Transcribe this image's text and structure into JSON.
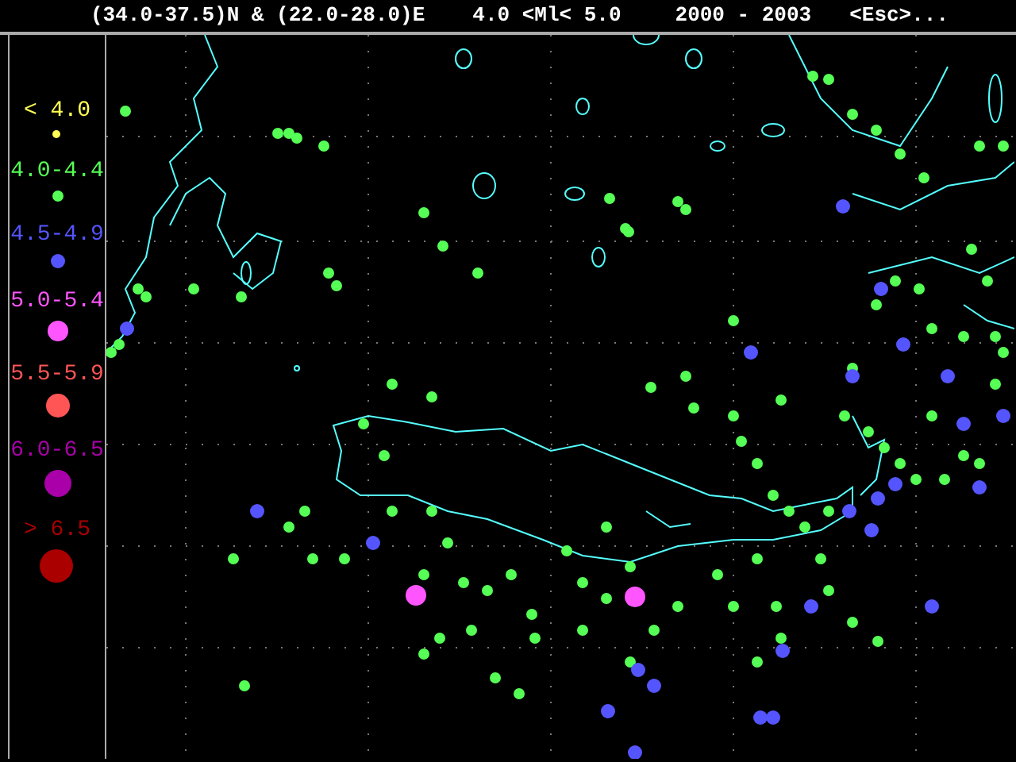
{
  "header": [
    "(34.0-37.5)N & (22.0-28.0)E",
    "4.0 <Ml< 5.0",
    "2000 - 2003",
    "<Esc>..."
  ],
  "legend": [
    {
      "label": "< 4.0",
      "color": "#ffff55"
    },
    {
      "label": "4.0-4.4",
      "color": "#55ff55"
    },
    {
      "label": "4.5-4.9",
      "color": "#5555ff"
    },
    {
      "label": "5.0-5.4",
      "color": "#ff55ff"
    },
    {
      "label": "5.5-5.9",
      "color": "#ff5555"
    },
    {
      "label": "6.0-6.5",
      "color": "#aa00aa"
    },
    {
      "label": "> 6.5",
      "color": "#aa0000"
    }
  ]
}
